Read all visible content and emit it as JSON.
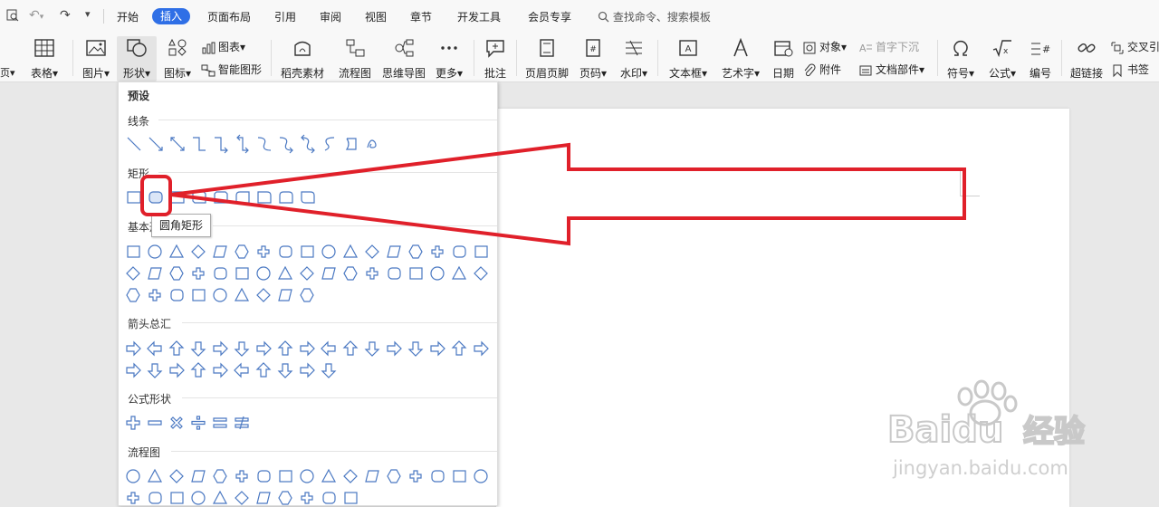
{
  "menu_tabs": [
    "开始",
    "插入",
    "页面布局",
    "引用",
    "审阅",
    "视图",
    "章节",
    "开发工具",
    "会员专享"
  ],
  "active_tab": "插入",
  "search_placeholder": "查找命令、搜索模板",
  "ribbon": {
    "table": "表格",
    "picture": "图片",
    "shape": "形状",
    "icon": "图标",
    "chart": "图表",
    "smart_art": "智能图形",
    "material": "稻壳素材",
    "flowchart": "流程图",
    "mindmap": "思维导图",
    "more": "更多",
    "comment": "批注",
    "header_footer": "页眉页脚",
    "page_number": "页码",
    "watermark": "水印",
    "textbox": "文本框",
    "wordart": "艺术字",
    "date": "日期",
    "object": "对象",
    "attachment": "附件",
    "dropcap": "首字下沉",
    "doc_parts": "文档部件",
    "symbol": "符号",
    "formula": "公式",
    "numbering": "编号",
    "hyperlink": "超链接",
    "crossref": "交叉引",
    "bookmark": "书签"
  },
  "dropdown": {
    "title": "预设",
    "sections": {
      "lines": "线条",
      "rect": "矩形",
      "basic": "基本形状",
      "arrows": "箭头总汇",
      "formula": "公式形状",
      "flow": "流程图"
    }
  },
  "tooltip": "圆角矩形",
  "watermark_text": {
    "brand": "Baidu",
    "cn": "经验",
    "url": "jingyan.baidu.com"
  },
  "colors": {
    "accent": "#2f6fe6",
    "annotation": "#e0202a",
    "shape_stroke": "#4a78c2"
  }
}
